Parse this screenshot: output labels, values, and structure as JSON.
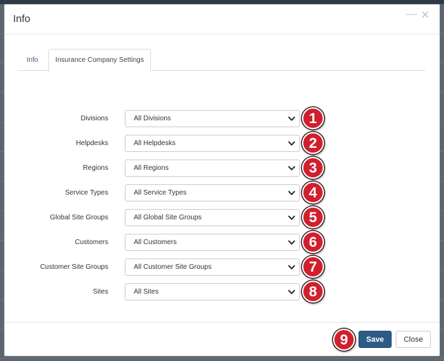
{
  "modal": {
    "title": "Info",
    "minimize_glyph": "—",
    "close_glyph": "✕"
  },
  "tabs": [
    {
      "label": "Info",
      "active": false
    },
    {
      "label": "Insurance Company Settings",
      "active": true
    }
  ],
  "form": {
    "rows": [
      {
        "label": "Divisions",
        "value": "All Divisions",
        "badge": "1"
      },
      {
        "label": "Helpdesks",
        "value": "All Helpdesks",
        "badge": "2"
      },
      {
        "label": "Regions",
        "value": "All Regions",
        "badge": "3"
      },
      {
        "label": "Service Types",
        "value": "All Service Types",
        "badge": "4"
      },
      {
        "label": "Global Site Groups",
        "value": "All Global Site Groups",
        "badge": "5"
      },
      {
        "label": "Customers",
        "value": "All Customers",
        "badge": "6"
      },
      {
        "label": "Customer Site Groups",
        "value": "All Customer Site Groups",
        "badge": "7"
      },
      {
        "label": "Sites",
        "value": "All Sites",
        "badge": "8"
      }
    ]
  },
  "footer": {
    "save_label": "Save",
    "close_label": "Close",
    "badge": "9"
  },
  "icons": {
    "select_arrow": "chevron-down-icon"
  },
  "colors": {
    "primary": "#2d5b87",
    "badge": "#d11f2e",
    "tab_link": "#3d5a80"
  }
}
